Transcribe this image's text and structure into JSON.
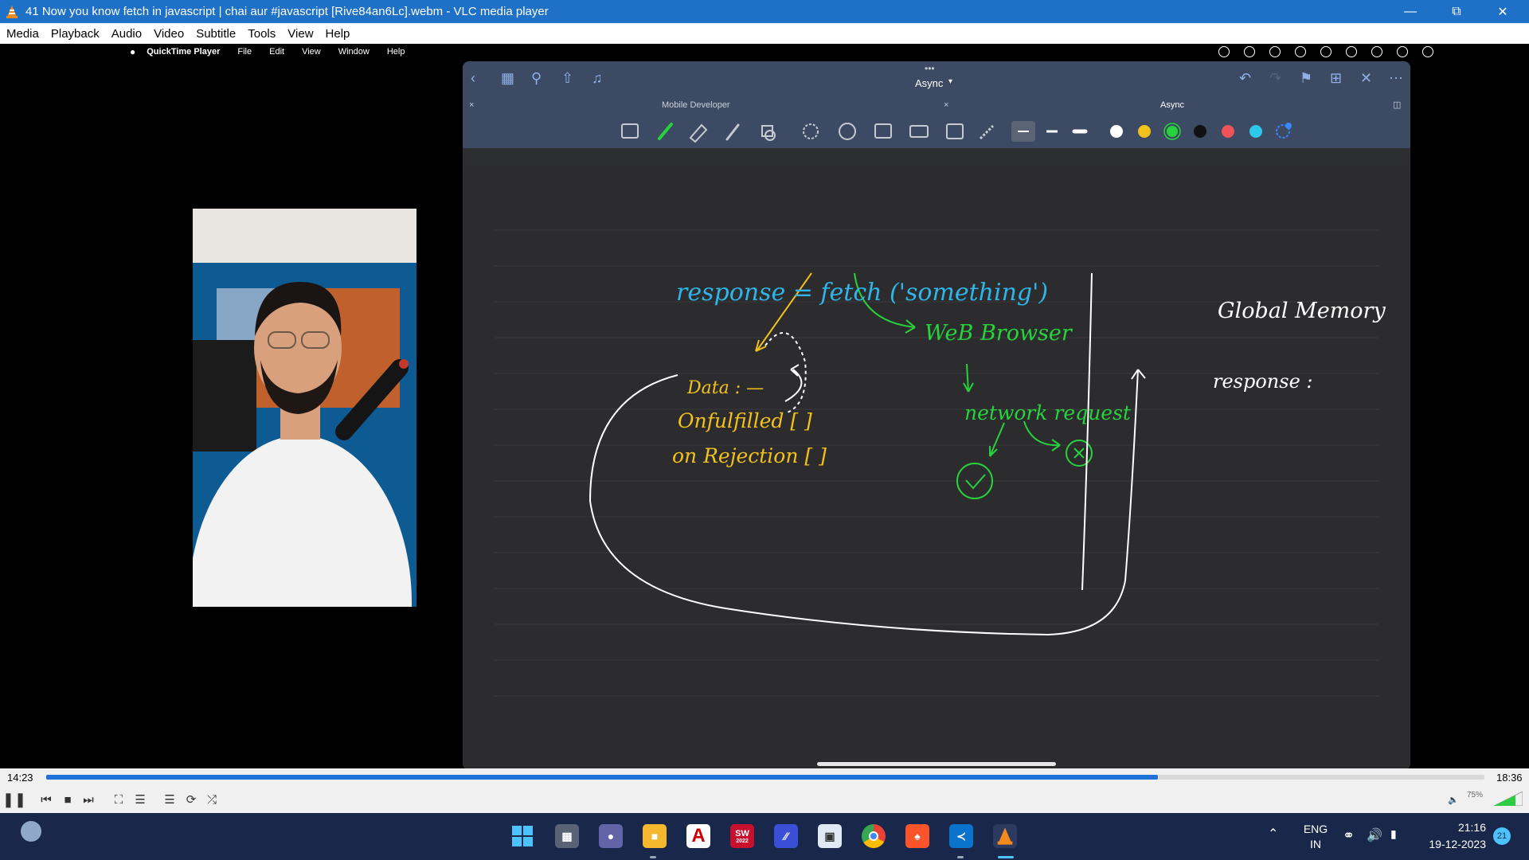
{
  "window": {
    "title": "41 Now you know fetch in javascript  |  chai aur #javascript [Rive84an6Lc].webm - VLC media player"
  },
  "menubar": {
    "items": [
      "Media",
      "Playback",
      "Audio",
      "Video",
      "Subtitle",
      "Tools",
      "View",
      "Help"
    ]
  },
  "mac_menubar": {
    "app": "QuickTime Player",
    "items": [
      "File",
      "Edit",
      "View",
      "Window",
      "Help"
    ]
  },
  "goodnotes": {
    "title": "Async",
    "tabs": [
      "Mobile Developer",
      "Async"
    ]
  },
  "whiteboard": {
    "line1": "response = fetch ('something')",
    "data_block": [
      "Data : —",
      "Onfulfilled [ ]",
      "on Rejection [ ]"
    ],
    "browser": "WeB Browser",
    "network": "network request",
    "global_memory": "Global Memory",
    "response_label": "response :"
  },
  "playback": {
    "elapsed": "14:23",
    "total": "18:36",
    "progress_fraction": 0.773,
    "volume": "75%"
  },
  "taskbar": {
    "lang_line1": "ENG",
    "lang_line2": "IN",
    "time": "21:16",
    "date": "19-12-2023",
    "notif_count": "21",
    "solidworks_badge": "2022"
  },
  "colors": {
    "vlc_blue": "#1f70c7",
    "goodnotes_header": "#3c4a63",
    "ink_blue": "#2fb5e8",
    "ink_yellow": "#f2c21b",
    "ink_green": "#27d33c",
    "ink_white": "#ffffff"
  }
}
